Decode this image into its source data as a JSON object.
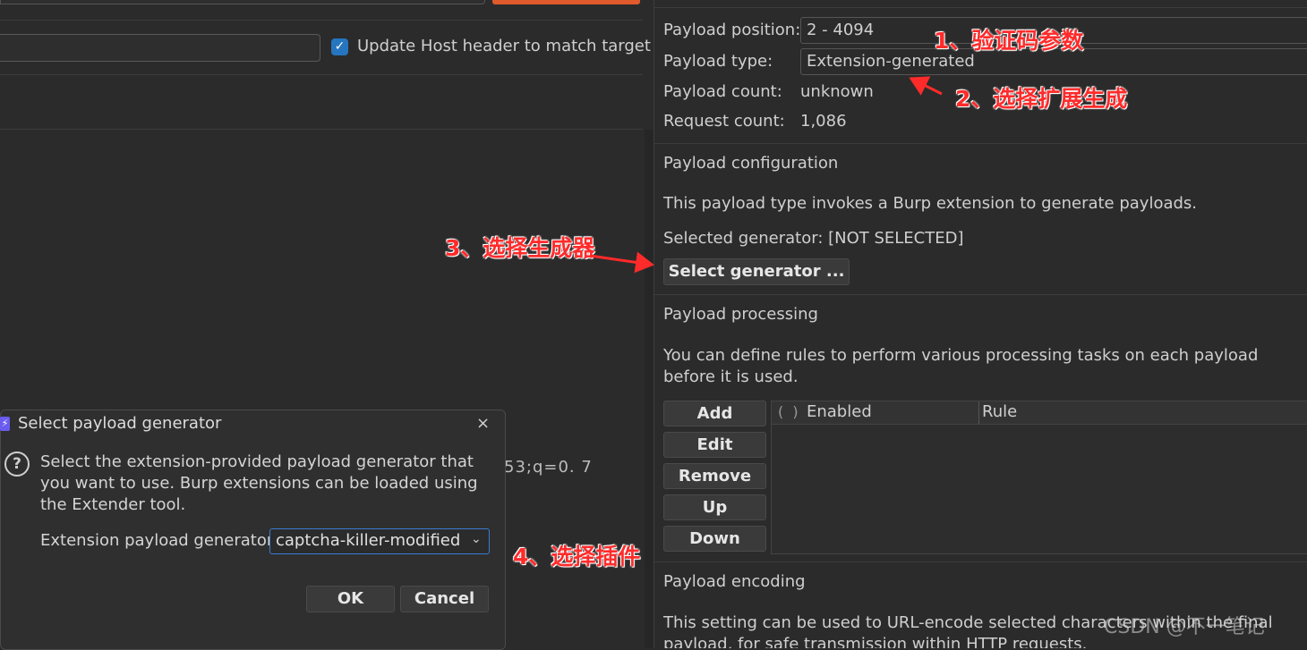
{
  "left": {
    "update_host_label": "Update Host header to match target",
    "update_host_checked": true,
    "background_text": "53;q=0. 7"
  },
  "payload_set": {
    "position_label": "Payload position:",
    "position_value": "2 - 4094",
    "type_label": "Payload type:",
    "type_value": "Extension-generated",
    "count_label": "Payload count:",
    "count_value": "unknown",
    "request_label": "Request count:",
    "request_value": "1,086"
  },
  "config": {
    "title": "Payload configuration",
    "description": "This payload type invokes a Burp extension to generate payloads.",
    "selected_generator": "Selected generator: [NOT SELECTED]",
    "select_button": "Select generator ..."
  },
  "processing": {
    "title": "Payload processing",
    "description": "You can define rules to perform various processing tasks on each payload before it is used.",
    "buttons": [
      "Add",
      "Edit",
      "Remove",
      "Up",
      "Down"
    ],
    "columns": [
      "Enabled",
      "Rule"
    ]
  },
  "encoding": {
    "title": "Payload encoding",
    "description": "This setting can be used to URL-encode selected characters within the final payload, for safe transmission within HTTP requests."
  },
  "dialog": {
    "title": "Select payload generator",
    "close": "×",
    "message": "Select the extension-provided payload generator that you want to use. Burp extensions can be loaded using the Extender tool.",
    "generator_label": "Extension payload generator:",
    "generator_value": "captcha-killer-modified",
    "ok": "OK",
    "cancel": "Cancel"
  },
  "annotations": {
    "step1": "1、验证码参数",
    "step2": "2、选择扩展生成",
    "step3": "3、选择生成器",
    "step4": "4、选择插件",
    "color": "#ff2b2b"
  },
  "watermark": "CSDN @不一笔记"
}
